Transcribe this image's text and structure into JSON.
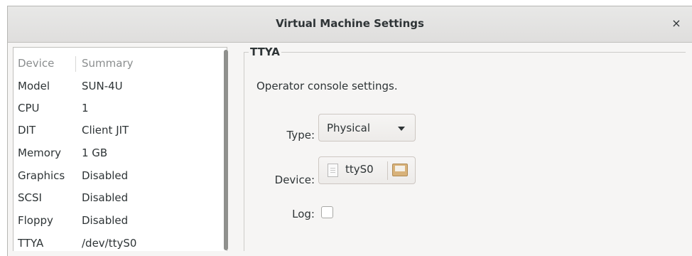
{
  "window": {
    "title": "Virtual Machine Settings",
    "close_glyph": "×"
  },
  "devices": {
    "headers": {
      "device": "Device",
      "summary": "Summary"
    },
    "rows": [
      {
        "device": "Model",
        "summary": "SUN-4U"
      },
      {
        "device": "CPU",
        "summary": "1"
      },
      {
        "device": "DIT",
        "summary": "Client JIT"
      },
      {
        "device": "Memory",
        "summary": "1 GB"
      },
      {
        "device": "Graphics",
        "summary": "Disabled"
      },
      {
        "device": "SCSI",
        "summary": "Disabled"
      },
      {
        "device": "Floppy",
        "summary": "Disabled"
      },
      {
        "device": "TTYA",
        "summary": "/dev/ttyS0"
      }
    ]
  },
  "panel": {
    "title": "TTYA",
    "description": "Operator console settings.",
    "type_label": "Type:",
    "type_value": "Physical",
    "device_label": "Device:",
    "device_value": "ttyS0",
    "log_label": "Log:",
    "log_checked": false
  },
  "icons": {
    "close": "close-icon",
    "dropdown": "chevron-down-icon",
    "file": "document-icon",
    "folder": "folder-icon"
  }
}
